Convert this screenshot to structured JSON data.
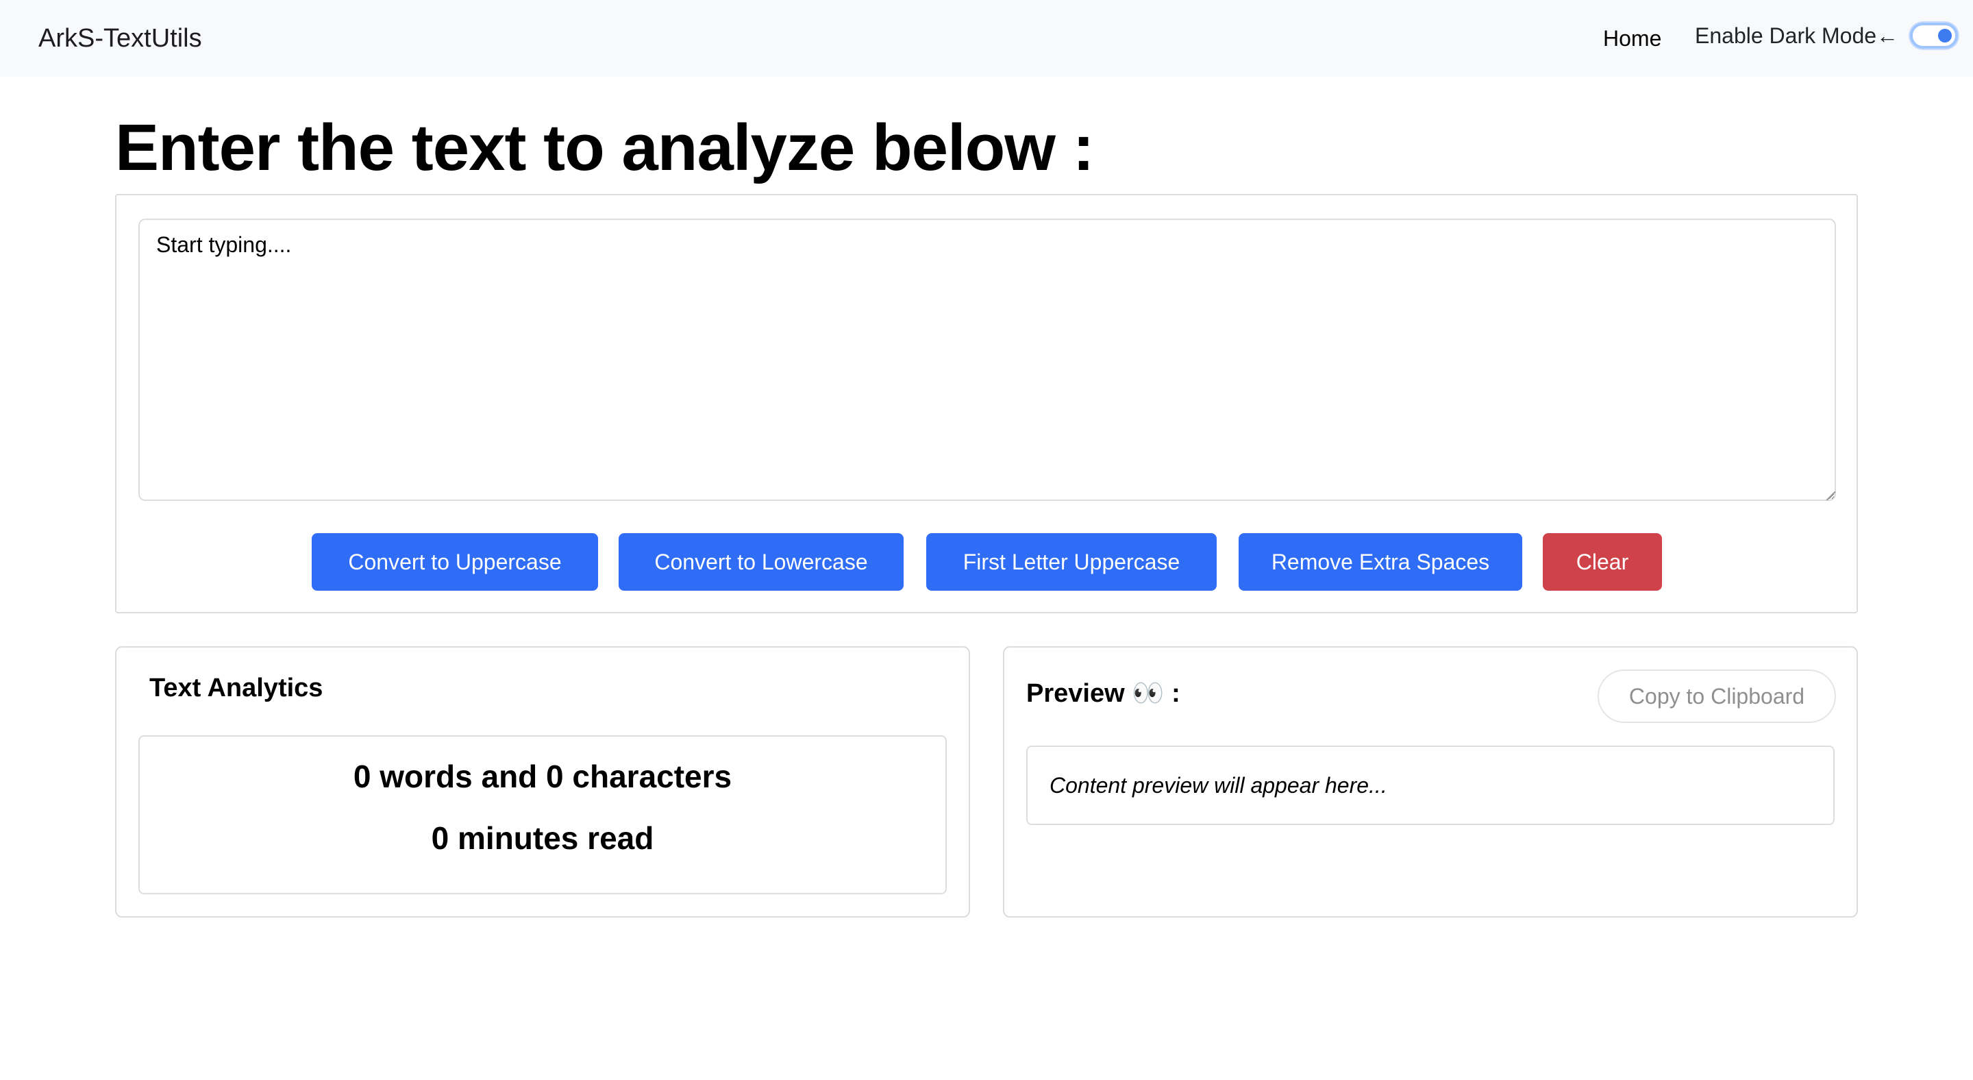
{
  "navbar": {
    "brand": "ArkS-TextUtils",
    "home_link": "Home",
    "dark_mode_label": "Enable Dark Mode←",
    "dark_mode_enabled": true
  },
  "main": {
    "title": "Enter the text to analyze below :",
    "textarea": {
      "placeholder": "Start typing....",
      "value": ""
    },
    "buttons": {
      "uppercase": "Convert to Uppercase",
      "lowercase": "Convert to Lowercase",
      "first_letter": "First Letter Uppercase",
      "remove_spaces": "Remove Extra Spaces",
      "clear": "Clear"
    }
  },
  "analytics": {
    "title": "Text Analytics",
    "words_chars": "0 words and 0 characters",
    "read_time": "0 minutes read"
  },
  "preview": {
    "title": "Preview 👀 :",
    "copy_button": "Copy to Clipboard",
    "placeholder": "Content preview will appear here..."
  },
  "colors": {
    "primary": "#2f6df6",
    "danger": "#cf4249",
    "navbar_bg": "#f8f9fa"
  }
}
